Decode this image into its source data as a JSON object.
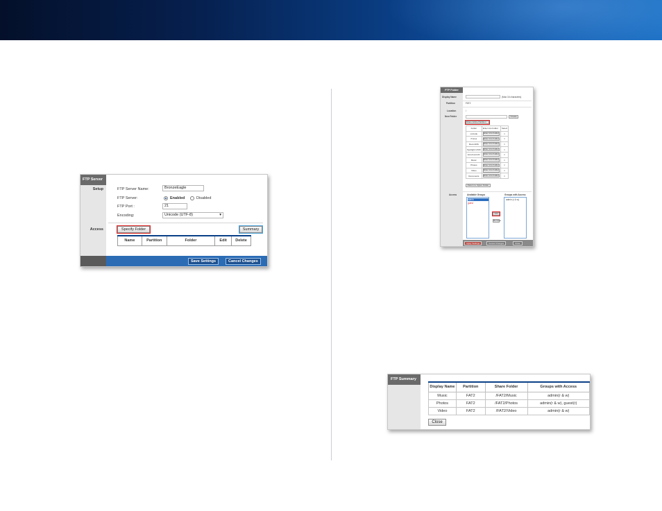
{
  "ftp_server": {
    "panel_title": "FTP Server",
    "section_setup": "Setup",
    "section_access": "Access",
    "server_name_label": "FTP Server Name:",
    "server_name_value": "BronzeEagle",
    "server_label": "FTP Server:",
    "enabled_label": "Enabled",
    "disabled_label": "Disabled",
    "port_label": "FTP Port :",
    "port_value": "21",
    "encoding_label": "Encoding:",
    "encoding_value": "Unicode (UTF-8)",
    "specify_folder_label": "Specify Folder",
    "summary_label": "Summary",
    "columns": [
      "Name",
      "Partition",
      "Folder",
      "Edit",
      "Delete"
    ],
    "save_label": "Save Settings",
    "cancel_label": "Cancel Changes"
  },
  "ftp_folder": {
    "panel_title": "FTP Folder",
    "display_name_label": "Display Name",
    "display_hint": "(Max 16 characters)",
    "partition_label": "Partition",
    "partition_value": "FAT2",
    "location_label": "Location",
    "location_value": "/",
    "new_folder_label": "New Folder",
    "create_label": "Create",
    "share_label": "Share Entire Partition",
    "table_header": [
      "Folder",
      "Enter into Folder",
      "Select"
    ],
    "folders": [
      {
        "name": "unicode",
        "enter": "Enter into Folder"
      },
      {
        "name": "iTunes",
        "enter": "Enter into Folder"
      },
      {
        "name": "RecordNS",
        "enter": "Enter into Folder"
      },
      {
        "name": "Spotlight-V100",
        "enter": "Enter into Folder"
      },
      {
        "name": "lost+found.dir",
        "enter": "Enter into Folder"
      },
      {
        "name": "Music",
        "enter": "Enter into Folder"
      },
      {
        "name": "Photos",
        "enter": "Enter into Folder"
      },
      {
        "name": "Video",
        "enter": "Enter into Folder"
      },
      {
        "name": "Documents",
        "enter": "Enter into Folder"
      }
    ],
    "return_label": "Return to Upper Folder",
    "access_label": "Access",
    "available_groups_label": "Available Groups",
    "available_groups": [
      "admin",
      "guest"
    ],
    "groups_with_access_label": "Groups with Access",
    "groups_with_access": [
      "admin (r & w)"
    ],
    "add_label": "Add",
    "remove_label": "Remove",
    "apply_label": "Apply Settings",
    "cancel_label": "Cancel Changes",
    "close_label": "Close"
  },
  "ftp_summary": {
    "panel_title": "FTP Summary",
    "columns": [
      "Display Name",
      "Partition",
      "Share Folder",
      "Groups with Access"
    ],
    "rows": [
      [
        "Music",
        "FAT2",
        "/FAT2/Music",
        "admin(r & w)"
      ],
      [
        "Photos",
        "FAT2",
        "/FAT2/Photos",
        "admin(r & w), guest(r)"
      ],
      [
        "Video",
        "FAT2",
        "/FAT2/Video",
        "admin(r & w)"
      ]
    ],
    "close_label": "Close"
  },
  "colors": {
    "banner": "#0a3f86",
    "panel_header": "#6a6a6a",
    "footer_blue": "#2b6cb5",
    "highlight": "#dd2222"
  }
}
